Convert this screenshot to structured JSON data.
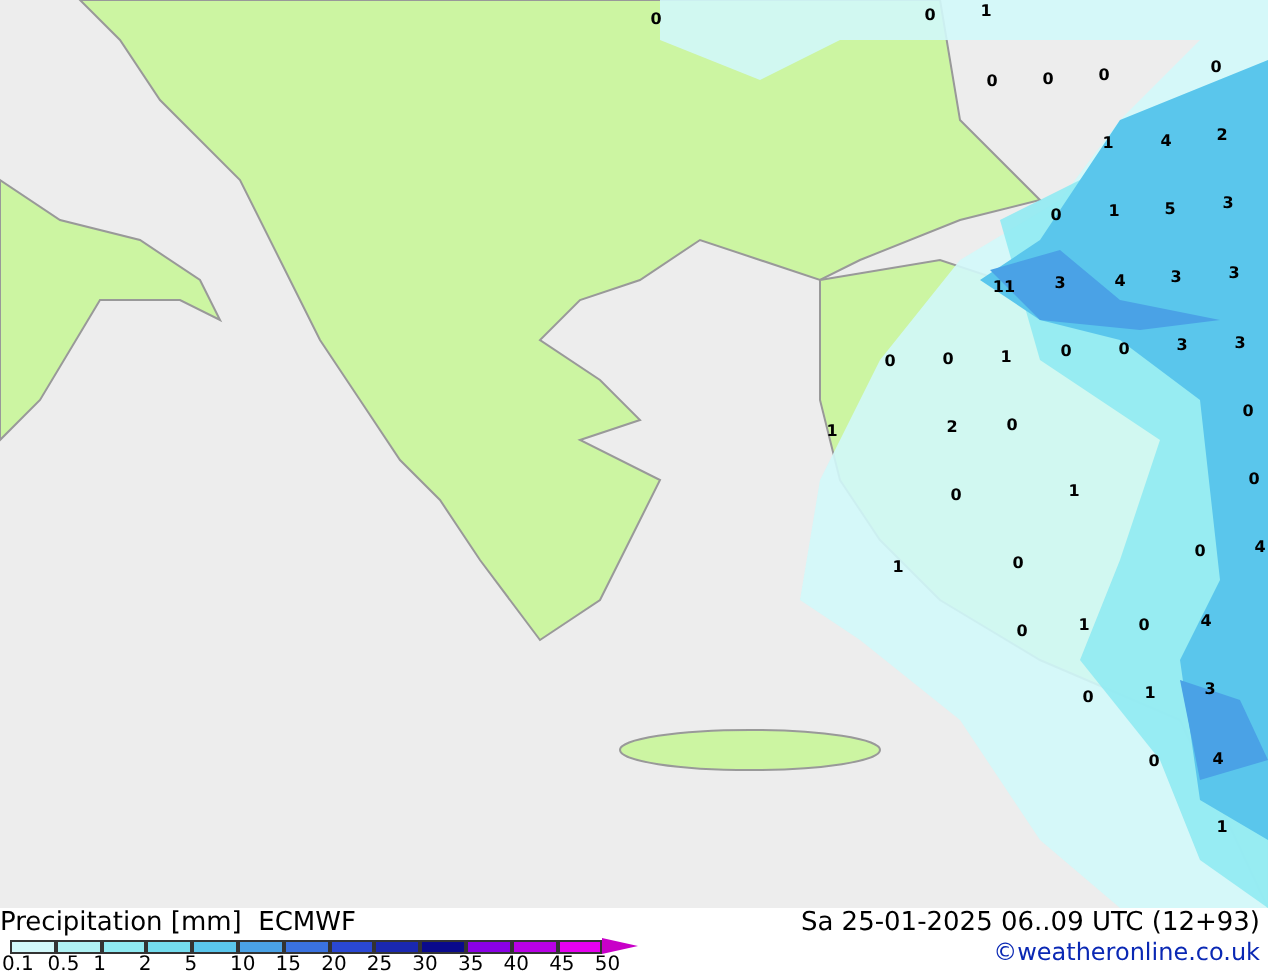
{
  "map": {
    "values": [
      "0",
      "1",
      "0",
      "0",
      "0",
      "0",
      "0",
      "1",
      "4",
      "2",
      "0",
      "1",
      "5",
      "3",
      "11",
      "3",
      "4",
      "3",
      "3",
      "0",
      "0",
      "1",
      "0",
      "0",
      "3",
      "3",
      "1",
      "2",
      "0",
      "0",
      "0",
      "1",
      "0",
      "1",
      "0",
      "0",
      "4",
      "0",
      "1",
      "0",
      "4",
      "0",
      "1",
      "3",
      "0",
      "4",
      "1"
    ]
  },
  "footer": {
    "title": "Precipitation [mm]",
    "model": "ECMWF",
    "date": "Sa 25-01-2025 06..09 UTC (12+93)",
    "credit": "©weatheronline.co.uk",
    "legend_bins": [
      {
        "color": "#d2f8fa"
      },
      {
        "color": "#b0f2f4"
      },
      {
        "color": "#90eaf2"
      },
      {
        "color": "#74dcee"
      },
      {
        "color": "#5ac6ec"
      },
      {
        "color": "#4aa2e6"
      },
      {
        "color": "#3a72e0"
      },
      {
        "color": "#2a48d4"
      },
      {
        "color": "#1a28b0"
      },
      {
        "color": "#0a0a8c"
      },
      {
        "color": "#8a00e6"
      },
      {
        "color": "#b800e6"
      },
      {
        "color": "#e600f0"
      },
      {
        "color": "#c800c8"
      }
    ],
    "legend_ticks": [
      "0.1",
      "0.5",
      "1",
      "2",
      "5",
      "10",
      "15",
      "20",
      "25",
      "30",
      "35",
      "40",
      "45",
      "50"
    ]
  }
}
